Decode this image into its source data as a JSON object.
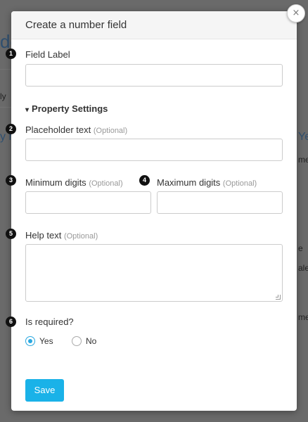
{
  "dialog": {
    "title": "Create a number field",
    "close_icon": "close-icon",
    "close_glyph": "×"
  },
  "fields": {
    "field_label": {
      "badge": "1",
      "label": "Field Label",
      "value": ""
    },
    "property_settings": {
      "label": "Property Settings",
      "icon": "chevron-down-icon",
      "glyph": "▾"
    },
    "placeholder_text": {
      "badge": "2",
      "label": "Placeholder text",
      "optional": "(Optional)",
      "value": ""
    },
    "minimum_digits": {
      "badge": "3",
      "label": "Minimum digits",
      "optional": "(Optional)",
      "value": ""
    },
    "maximum_digits": {
      "badge": "4",
      "label": "Maximum digits",
      "optional": "(Optional)",
      "value": ""
    },
    "help_text": {
      "badge": "5",
      "label": "Help text",
      "optional": "(Optional)",
      "value": ""
    },
    "is_required": {
      "badge": "6",
      "label": "Is required?",
      "options": [
        {
          "label": "Yes",
          "selected": true
        },
        {
          "label": "No",
          "selected": false
        }
      ]
    }
  },
  "actions": {
    "save_label": "Save"
  },
  "background": {
    "fragments": [
      "de",
      "ly",
      "y n",
      "Ye",
      "me",
      "e",
      "ale",
      "me"
    ]
  },
  "colors": {
    "accent": "#1ab2e8",
    "radio_selected": "#2aa8e0",
    "badge": "#111111"
  }
}
